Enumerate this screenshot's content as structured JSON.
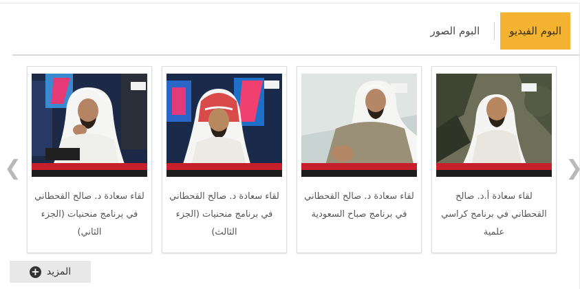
{
  "tabs": {
    "photo_album": "البوم الصور",
    "video_album": "البوم الفيديو"
  },
  "nav": {
    "prev_icon": "chevron-left-icon",
    "next_icon": "chevron-right-icon"
  },
  "videos": [
    {
      "caption": "لقاء سعادة أ.د. صالح القحطاني في برنامج كراسي علمية"
    },
    {
      "caption": "لقاء سعادة د. صالح القحطاني في برنامج صباح السعودية"
    },
    {
      "caption": "لقاء سعادة د. صالح القحطاني في برنامج منحنيات (الجزء الثالث)"
    },
    {
      "caption": "لقاء سعادة د. صالح القحطاني في برنامج منحنيات (الجزء الثاني)"
    }
  ],
  "more_button": {
    "label": "المزيد",
    "icon": "plus-circle-icon"
  },
  "colors": {
    "active_tab": "#f5b332",
    "ticker_red": "#c8202a"
  }
}
